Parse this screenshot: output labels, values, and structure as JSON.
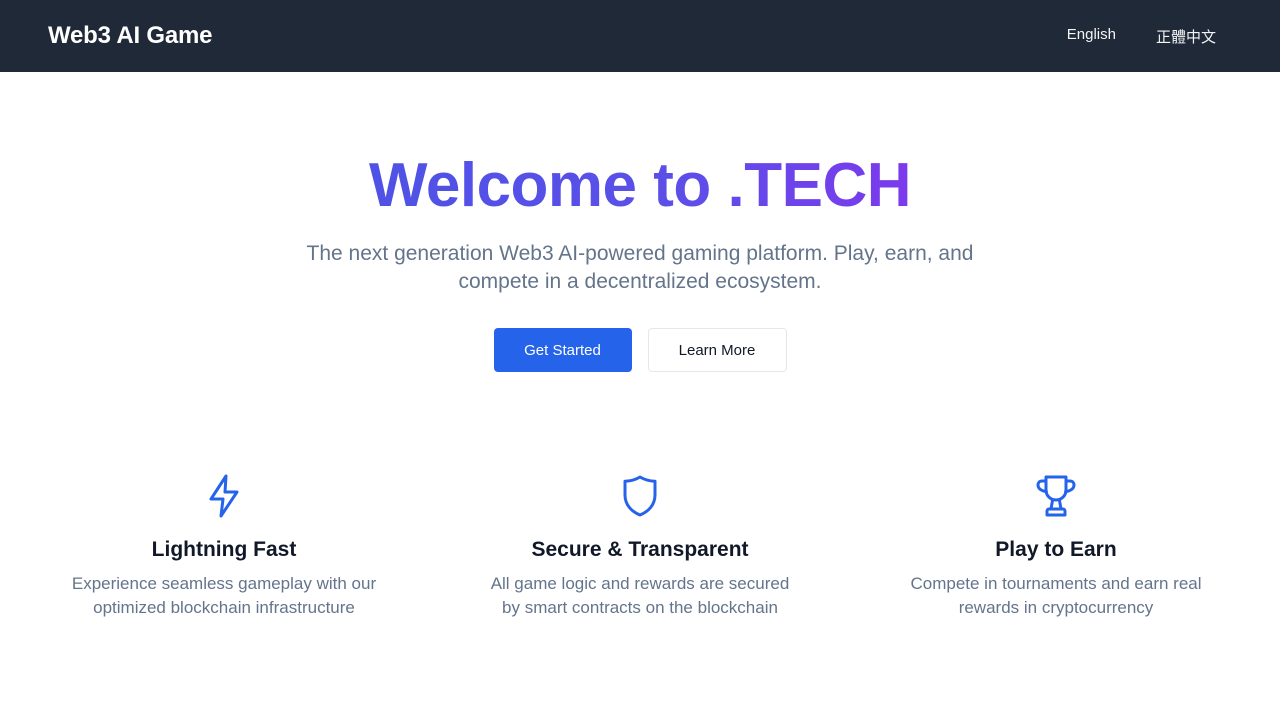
{
  "navbar": {
    "brand": "Web3 AI Game",
    "links": [
      {
        "label": "English"
      },
      {
        "label": "正體中文"
      }
    ]
  },
  "hero": {
    "title": "Welcome to .TECH",
    "subtitle": "The next generation Web3 AI-powered gaming platform. Play, earn, and compete in a decentralized ecosystem.",
    "primary_button": "Get Started",
    "secondary_button": "Learn More"
  },
  "features": [
    {
      "icon": "lightning-icon",
      "title": "Lightning Fast",
      "description": "Experience seamless gameplay with our optimized blockchain infrastructure"
    },
    {
      "icon": "shield-icon",
      "title": "Secure & Transparent",
      "description": "All game logic and rewards are secured by smart contracts on the blockchain"
    },
    {
      "icon": "trophy-icon",
      "title": "Play to Earn",
      "description": "Compete in tournaments and earn real rewards in cryptocurrency"
    }
  ],
  "colors": {
    "navbar_bg": "#1f2937",
    "accent": "#2563eb",
    "title_gradient_start": "#4f52e6",
    "title_gradient_end": "#7c3aed",
    "muted_text": "#64748b"
  }
}
